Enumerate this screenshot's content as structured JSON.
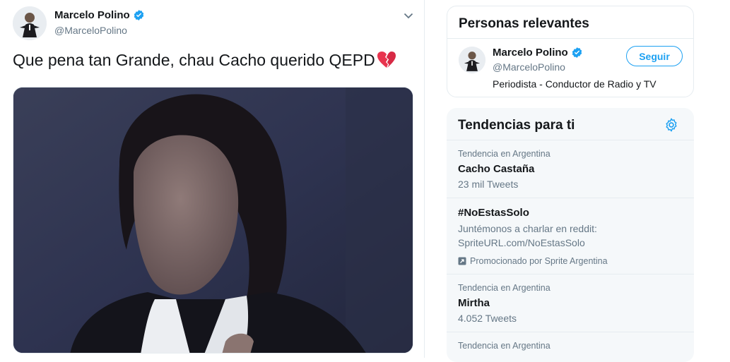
{
  "tweet": {
    "author_name": "Marcelo Polino",
    "author_handle": "@MarceloPolino",
    "text": "Que pena tan Grande, chau Cacho querido QEPD",
    "emoji": "broken-heart-icon"
  },
  "relevant_people": {
    "title": "Personas relevantes",
    "person": {
      "name": "Marcelo Polino",
      "handle": "@MarceloPolino",
      "bio": "Periodista - Conductor de Radio y TV",
      "follow_label": "Seguir"
    }
  },
  "trends": {
    "title": "Tendencias para ti",
    "items": [
      {
        "meta": "Tendencia en Argentina",
        "name": "Cacho Castaña",
        "count": "23 mil Tweets"
      },
      {
        "name": "#NoEstasSolo",
        "desc_line1": "Juntémonos a charlar en reddit:",
        "desc_line2": "SpriteURL.com/NoEstasSolo",
        "promoted": "Promocionado por Sprite Argentina"
      },
      {
        "meta": "Tendencia en Argentina",
        "name": "Mirtha",
        "count": "4.052 Tweets"
      },
      {
        "meta": "Tendencia en Argentina"
      }
    ]
  },
  "colors": {
    "accent": "#1da1f2",
    "text_primary": "#14171a",
    "text_secondary": "#657786",
    "border": "#e6ecf0",
    "panel_bg": "#f5f8fa"
  }
}
